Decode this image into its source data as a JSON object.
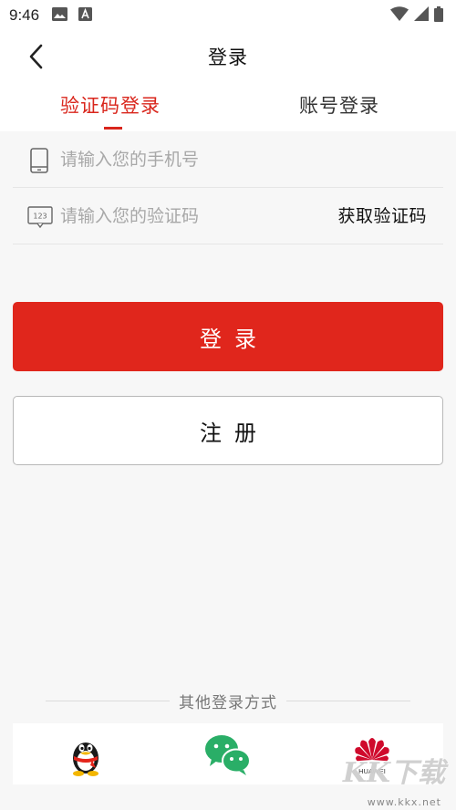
{
  "status_bar": {
    "time": "9:46",
    "icons_left": [
      "image-icon",
      "text-a-icon"
    ],
    "icons_right": [
      "wifi-icon",
      "signal-icon",
      "battery-icon"
    ]
  },
  "header": {
    "title": "登录",
    "back_icon": "chevron-left-icon"
  },
  "tabs": [
    {
      "label": "验证码登录",
      "active": true
    },
    {
      "label": "账号登录",
      "active": false
    }
  ],
  "form": {
    "phone_placeholder": "请输入您的手机号",
    "phone_value": "",
    "code_placeholder": "请输入您的验证码",
    "code_value": "",
    "get_code_label": "获取验证码"
  },
  "buttons": {
    "login_label": "登录",
    "register_label": "注册"
  },
  "other_login": {
    "label": "其他登录方式",
    "providers": [
      "qq-icon",
      "wechat-icon",
      "huawei-icon"
    ]
  },
  "colors": {
    "accent": "#e0261c",
    "tab_active": "#d9261c",
    "background": "#f7f7f7"
  },
  "watermark": {
    "logo": "KK下载",
    "url": "www.kkx.net"
  }
}
